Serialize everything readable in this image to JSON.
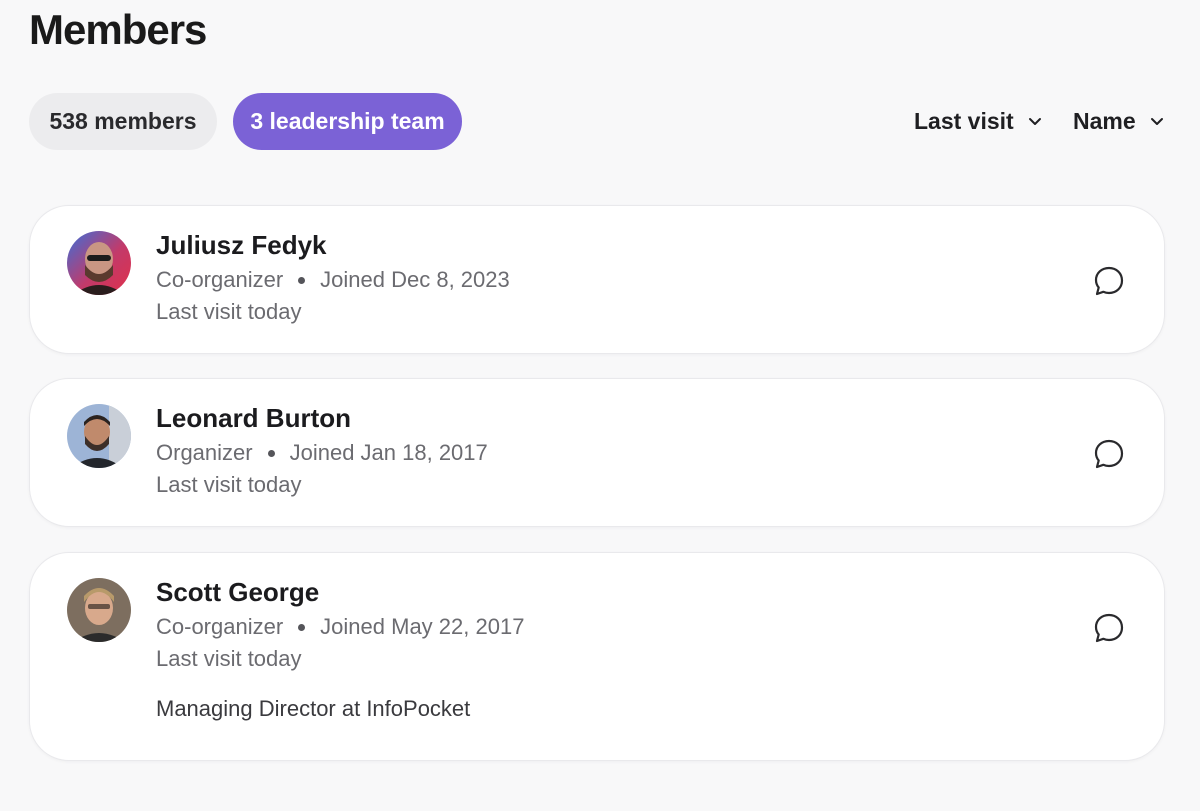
{
  "page": {
    "title": "Members"
  },
  "filters": {
    "members_label": "538 members",
    "leadership_label": "3 leadership team",
    "active_color": "#7b62d6"
  },
  "sort": {
    "visit_label": "Last visit",
    "name_label": "Name"
  },
  "members": [
    {
      "name": "Juliusz Fedyk",
      "role": "Co-organizer",
      "joined": "Joined Dec 8, 2023",
      "last_visit": "Last visit today"
    },
    {
      "name": "Leonard Burton",
      "role": "Organizer",
      "joined": "Joined Jan 18, 2017",
      "last_visit": "Last visit today"
    },
    {
      "name": "Scott George",
      "role": "Co-organizer",
      "joined": "Joined May 22, 2017",
      "last_visit": "Last visit today",
      "bio": "Managing Director at InfoPocket"
    }
  ]
}
